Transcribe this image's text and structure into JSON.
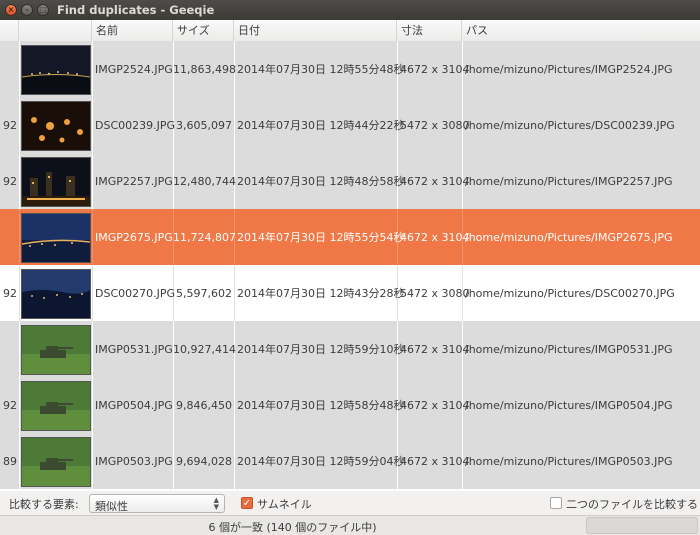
{
  "window": {
    "title": "Find duplicates - Geeqie"
  },
  "columns": [
    "名前",
    "サイズ",
    "日付",
    "寸法",
    "パス"
  ],
  "rows": [
    {
      "rank": "",
      "name": "IMGP2524.JPG",
      "size": "11,863,498",
      "date": "2014年07月30日 12時55分48秒",
      "dims": "4672 x 3104",
      "path": "/home/mizuno/Pictures/IMGP2524.JPG",
      "thumb": "night-harbor-thumbnail",
      "style": "grey"
    },
    {
      "rank": "92",
      "name": "DSC00239.JPG",
      "size": "3,605,097",
      "date": "2014年07月30日 12時44分22秒",
      "dims": "5472 x 3080",
      "path": "/home/mizuno/Pictures/DSC00239.JPG",
      "thumb": "night-lights-thumbnail",
      "style": "grey"
    },
    {
      "rank": "92",
      "name": "IMGP2257.JPG",
      "size": "12,480,744",
      "date": "2014年07月30日 12時48分58秒",
      "dims": "4672 x 3104",
      "path": "/home/mizuno/Pictures/IMGP2257.JPG",
      "thumb": "night-city-thumbnail",
      "style": "grey"
    },
    {
      "rank": "",
      "name": "IMGP2675.JPG",
      "size": "11,724,807",
      "date": "2014年07月30日 12時55分54秒",
      "dims": "4672 x 3104",
      "path": "/home/mizuno/Pictures/IMGP2675.JPG",
      "thumb": "dusk-city-thumbnail",
      "style": "sel"
    },
    {
      "rank": "92",
      "name": "DSC00270.JPG",
      "size": "5,597,602",
      "date": "2014年07月30日 12時43分28秒",
      "dims": "5472 x 3080",
      "path": "/home/mizuno/Pictures/DSC00270.JPG",
      "thumb": "dusk-bay-thumbnail",
      "style": "white"
    },
    {
      "rank": "",
      "name": "IMGP0531.JPG",
      "size": "10,927,414",
      "date": "2014年07月30日 12時59分10秒",
      "dims": "4672 x 3104",
      "path": "/home/mizuno/Pictures/IMGP0531.JPG",
      "thumb": "tank-field-thumbnail",
      "style": "grey"
    },
    {
      "rank": "92",
      "name": "IMGP0504.JPG",
      "size": "9,846,450",
      "date": "2014年07月30日 12時58分48秒",
      "dims": "4672 x 3104",
      "path": "/home/mizuno/Pictures/IMGP0504.JPG",
      "thumb": "tank-field-thumbnail",
      "style": "grey"
    },
    {
      "rank": "89",
      "name": "IMGP0503.JPG",
      "size": "9,694,028",
      "date": "2014年07月30日 12時59分04秒",
      "dims": "4672 x 3104",
      "path": "/home/mizuno/Pictures/IMGP0503.JPG",
      "thumb": "tank-field-thumbnail",
      "style": "grey"
    }
  ],
  "bottom": {
    "compare_label": "比較する要素:",
    "compare_value": "類似性",
    "thumbnail_label": "サムネイル",
    "thumbnail_checked": true,
    "compare_two_label": "二つのファイルを比較する",
    "compare_two_checked": false
  },
  "status": {
    "text": "6 個が一致 (140 個のファイル中)"
  },
  "colors": {
    "selection": "#f07746",
    "row_grey": "#dcdcdc",
    "titlebar": "#3c3b37",
    "accent": "#e96a3a"
  }
}
